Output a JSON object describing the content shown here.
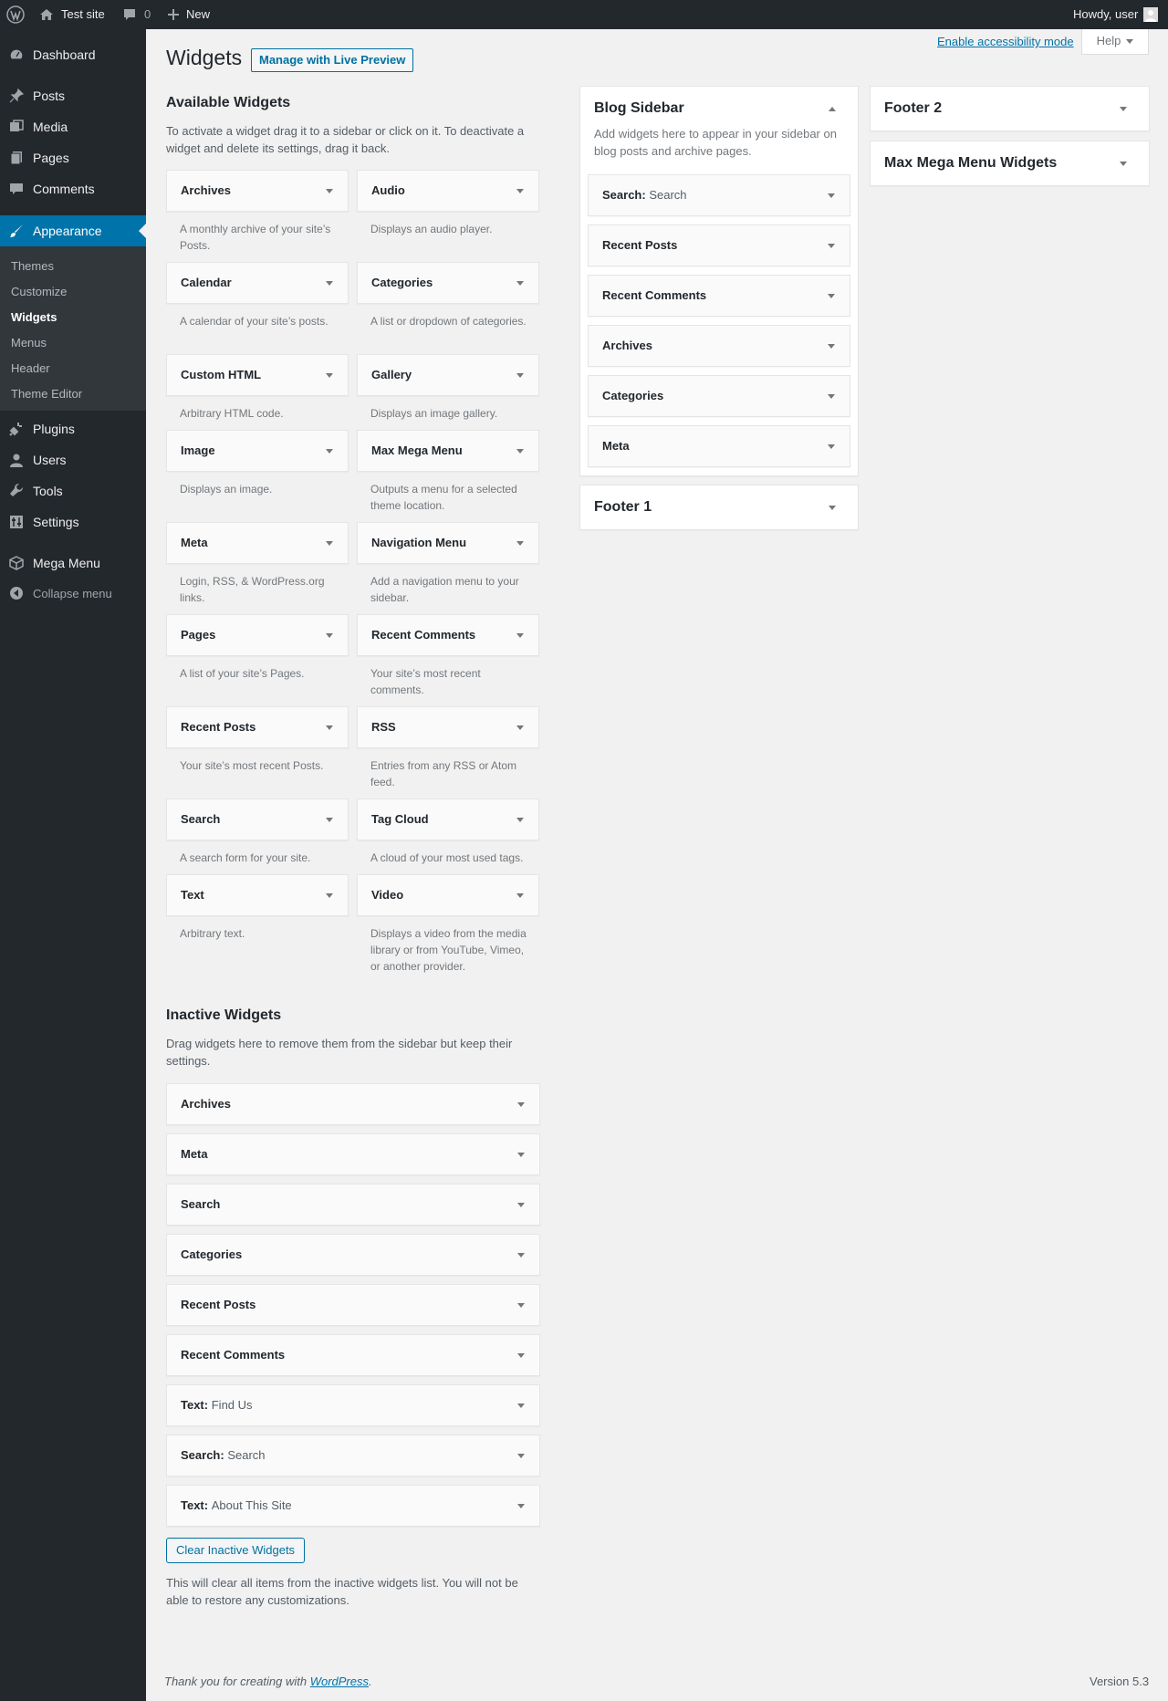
{
  "adminbar": {
    "site_name": "Test site",
    "comments_count": "0",
    "new_label": "New",
    "howdy": "Howdy, user"
  },
  "menu": {
    "dashboard": "Dashboard",
    "posts": "Posts",
    "media": "Media",
    "pages": "Pages",
    "comments": "Comments",
    "appearance": "Appearance",
    "submenu": [
      "Themes",
      "Customize",
      "Widgets",
      "Menus",
      "Header",
      "Theme Editor"
    ],
    "plugins": "Plugins",
    "users": "Users",
    "tools": "Tools",
    "settings": "Settings",
    "mega_menu": "Mega Menu",
    "collapse": "Collapse menu"
  },
  "header": {
    "title": "Widgets",
    "live_preview": "Manage with Live Preview",
    "accessibility": "Enable accessibility mode",
    "help": "Help"
  },
  "available": {
    "title": "Available Widgets",
    "description": "To activate a widget drag it to a sidebar or click on it. To deactivate a widget and delete its settings, drag it back.",
    "widgets": [
      {
        "title": "Archives",
        "desc": "A monthly archive of your site’s Posts."
      },
      {
        "title": "Audio",
        "desc": "Displays an audio player."
      },
      {
        "title": "Calendar",
        "desc": "A calendar of your site’s posts."
      },
      {
        "title": "Categories",
        "desc": "A list or dropdown of categories."
      },
      {
        "title": "Custom HTML",
        "desc": "Arbitrary HTML code."
      },
      {
        "title": "Gallery",
        "desc": "Displays an image gallery."
      },
      {
        "title": "Image",
        "desc": "Displays an image."
      },
      {
        "title": "Max Mega Menu",
        "desc": "Outputs a menu for a selected theme location."
      },
      {
        "title": "Meta",
        "desc": "Login, RSS, & WordPress.org links."
      },
      {
        "title": "Navigation Menu",
        "desc": "Add a navigation menu to your sidebar."
      },
      {
        "title": "Pages",
        "desc": "A list of your site’s Pages."
      },
      {
        "title": "Recent Comments",
        "desc": "Your site’s most recent comments."
      },
      {
        "title": "Recent Posts",
        "desc": "Your site’s most recent Posts."
      },
      {
        "title": "RSS",
        "desc": "Entries from any RSS or Atom feed."
      },
      {
        "title": "Search",
        "desc": "A search form for your site."
      },
      {
        "title": "Tag Cloud",
        "desc": "A cloud of your most used tags."
      },
      {
        "title": "Text",
        "desc": "Arbitrary text."
      },
      {
        "title": "Video",
        "desc": "Displays a video from the media library or from YouTube, Vimeo, or another provider."
      }
    ]
  },
  "inactive": {
    "title": "Inactive Widgets",
    "description": "Drag widgets here to remove them from the sidebar but keep their settings.",
    "widgets": [
      {
        "title": "Archives",
        "inside": ""
      },
      {
        "title": "Meta",
        "inside": ""
      },
      {
        "title": "Search",
        "inside": ""
      },
      {
        "title": "Categories",
        "inside": ""
      },
      {
        "title": "Recent Posts",
        "inside": ""
      },
      {
        "title": "Recent Comments",
        "inside": ""
      },
      {
        "title": "Text:",
        "inside": "Find Us"
      },
      {
        "title": "Search:",
        "inside": "Search"
      },
      {
        "title": "Text:",
        "inside": "About This Site"
      }
    ],
    "clear_button": "Clear Inactive Widgets",
    "clear_note": "This will clear all items from the inactive widgets list. You will not be able to restore any customizations."
  },
  "sidebars": {
    "blog": {
      "title": "Blog Sidebar",
      "description": "Add widgets here to appear in your sidebar on blog posts and archive pages.",
      "widgets": [
        {
          "title": "Search:",
          "inside": "Search"
        },
        {
          "title": "Recent Posts",
          "inside": ""
        },
        {
          "title": "Recent Comments",
          "inside": ""
        },
        {
          "title": "Archives",
          "inside": ""
        },
        {
          "title": "Categories",
          "inside": ""
        },
        {
          "title": "Meta",
          "inside": ""
        }
      ]
    },
    "footer1": {
      "title": "Footer 1"
    },
    "footer2": {
      "title": "Footer 2"
    },
    "maxmega": {
      "title": "Max Mega Menu Widgets"
    }
  },
  "footer": {
    "thanks_prefix": "Thank you for creating with",
    "wordpress_link": "WordPress",
    "thanks_suffix": ".",
    "version": "Version 5.3"
  },
  "colors": {
    "adminbar_bg": "#23282d",
    "menu_current": "#0073aa",
    "link": "#0073aa",
    "page_bg": "#f1f1f1"
  }
}
